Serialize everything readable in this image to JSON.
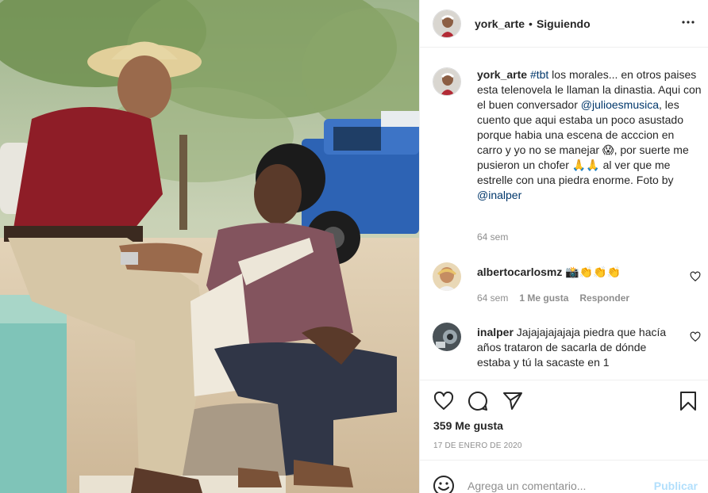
{
  "post": {
    "photo_alt": "",
    "header": {
      "username": "york_arte",
      "separator": "•",
      "follow_status": "Siguiendo",
      "more_icon": "more-horizontal-icon"
    },
    "caption": {
      "username": "york_arte",
      "hashtag": "#tbt",
      "text_part1": " los morales... en otros paises esta telenovela le llaman la dinastia. Aqui con el buen conversador ",
      "mention1": "@julioesmusica",
      "text_part2": ", les cuento que aqui estaba un poco asustado porque habia una escena de acccion en carro y yo no se manejar ",
      "emoji1": "😱",
      "text_part3": ", por suerte me pusieron un chofer ",
      "emoji2": "🙏🙏",
      "text_part4": " al ver que me estrelle con una piedra enorme. Foto by ",
      "mention2": "@inalper",
      "time": "64 sem"
    },
    "comments": [
      {
        "username": "albertocarlosmz",
        "text": " 📸👏👏👏",
        "time": "64 sem",
        "likes": "1 Me gusta",
        "reply": "Responder"
      },
      {
        "username": "inalper",
        "text": " Jajajajajajaja piedra que hacía años trataron de sacarla de dónde estaba y tú la sacaste en 1",
        "time": "",
        "likes": "",
        "reply": ""
      }
    ],
    "likes": "359 Me gusta",
    "date": "17 DE ENERO DE 2020",
    "comment_box": {
      "placeholder": "Agrega un comentario...",
      "publish": "Publicar"
    },
    "icons": {
      "like": "heart-icon",
      "comment": "comment-icon",
      "share": "send-icon",
      "save": "bookmark-icon",
      "emoji": "smile-icon"
    },
    "colors": {
      "link": "#00376b",
      "muted": "#8e8e8e",
      "publish_disabled": "#b2dffc",
      "border": "#efefef"
    }
  }
}
